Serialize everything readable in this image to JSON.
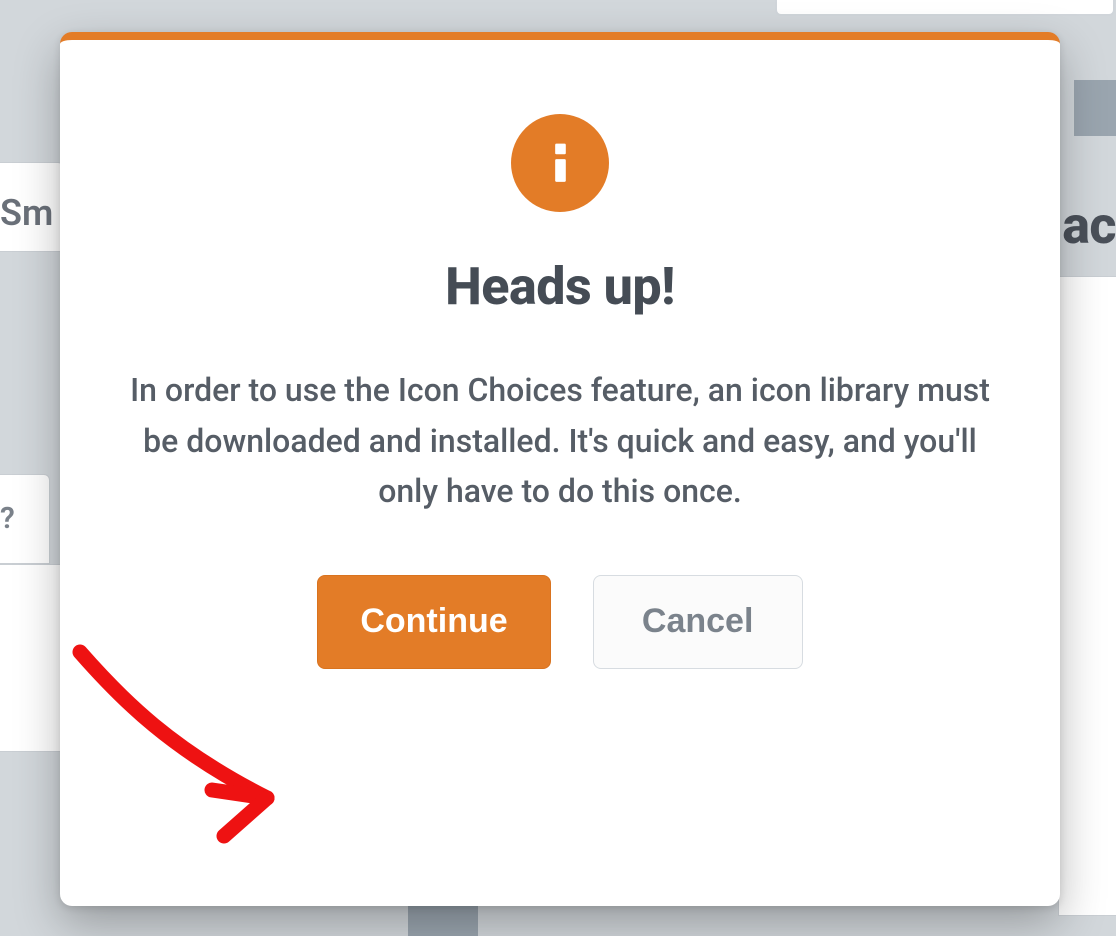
{
  "background": {
    "partial_text_left_top": "Sm",
    "partial_text_left_mid": "?",
    "partial_text_right": "ac"
  },
  "modal": {
    "icon": "info-icon",
    "accent_color": "#e37c27",
    "title": "Heads up!",
    "body": "In order to use the Icon Choices feature, an icon library must be downloaded and installed. It's quick and easy, and you'll only have to do this once.",
    "buttons": {
      "primary": "Continue",
      "secondary": "Cancel"
    }
  },
  "annotation": {
    "type": "arrow",
    "color": "#ee1212",
    "points_to": "continue-button"
  }
}
